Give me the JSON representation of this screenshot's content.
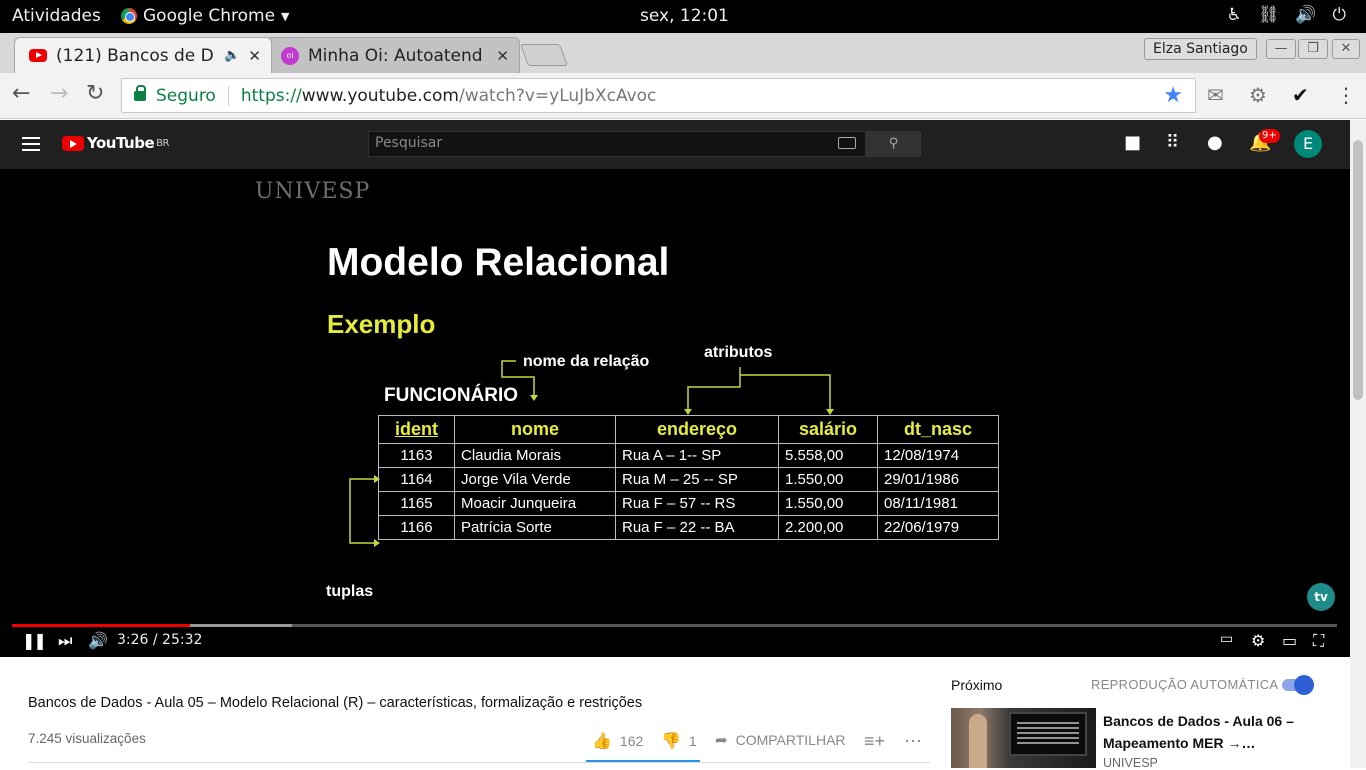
{
  "os": {
    "activities": "Atividades",
    "app_name": "Google Chrome",
    "clock": "sex, 12:01"
  },
  "browser": {
    "tabs": [
      {
        "title": "(121) Bancos de D",
        "favicon": "youtube-icon",
        "audio": true
      },
      {
        "title": "Minha Oi: Autoatend",
        "favicon": "oi-icon"
      }
    ],
    "user": "Elza Santiago",
    "secure_label": "Seguro",
    "url": {
      "scheme": "https://",
      "host": "www.youtube.com",
      "path": "/watch?v=yLuJbXcAvoc"
    }
  },
  "youtube": {
    "logo": "YouTube",
    "region": "BR",
    "search_placeholder": "Pesquisar",
    "notifications": "9+",
    "avatar_letter": "E"
  },
  "slide": {
    "brand": "UNIVESP",
    "title": "Modelo Relacional",
    "subtitle": "Exemplo",
    "label_relation": "nome da relação",
    "label_attrs": "atributos",
    "label_tuples": "tuplas",
    "relation_name": "FUNCIONÁRIO",
    "tv_logo": "tv",
    "columns": [
      "ident",
      "nome",
      "endereço",
      "salário",
      "dt_nasc"
    ],
    "rows": [
      [
        "1163",
        "Claudia Morais",
        "Rua A – 1-- SP",
        "5.558,00",
        "12/08/1974"
      ],
      [
        "1164",
        "Jorge Vila Verde",
        "Rua M – 25 --  SP",
        "1.550,00",
        "29/01/1986"
      ],
      [
        "1165",
        "Moacir Junqueira",
        "Rua F – 57 -- RS",
        "1.550,00",
        "08/11/1981"
      ],
      [
        "1166",
        "Patrícia Sorte",
        "Rua F – 22 -- BA",
        "2.200,00",
        "22/06/1979"
      ]
    ]
  },
  "player": {
    "time": "3:26 / 25:32",
    "played_fraction": 0.134,
    "buffered_fraction": 0.211
  },
  "video": {
    "title": "Bancos de Dados - Aula 05 – Modelo Relacional (R) – características, formalização e restrições",
    "views": "7.245 visualizações",
    "likes": "162",
    "dislikes": "1",
    "share": "COMPARTILHAR"
  },
  "sidebar": {
    "next_label": "Próximo",
    "autoplay_label": "REPRODUÇÃO AUTOMÁTICA",
    "autoplay_on": true,
    "next_title": "Bancos de Dados - Aula 06 – Mapeamento MER →…",
    "next_channel": "UNIVESP"
  },
  "colors": {
    "accent_red": "#ee0000",
    "slide_yellow": "#e6ec3a",
    "secure_green": "#0b8043",
    "toggle_blue": "#2f5fd6"
  }
}
